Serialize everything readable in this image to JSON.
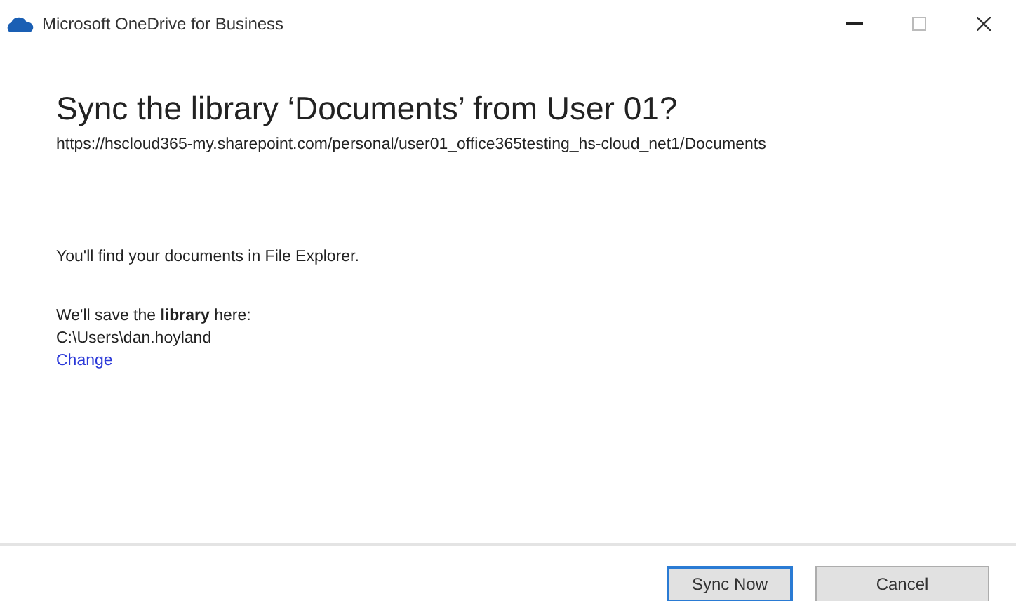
{
  "window": {
    "title": "Microsoft OneDrive for Business"
  },
  "heading": "Sync the library ‘Documents’ from User 01?",
  "url": "https://hscloud365-my.sharepoint.com/personal/user01_office365testing_hs-cloud_net1/Documents",
  "info": "You'll find your documents in File Explorer.",
  "save_label": "We'll save the **library** here:",
  "save_path": "C:\\Users\\dan.hoyland",
  "change_link": "Change",
  "buttons": [
    {
      "label": "Sync Now",
      "default": true
    },
    {
      "label": "Cancel",
      "default": false
    }
  ]
}
